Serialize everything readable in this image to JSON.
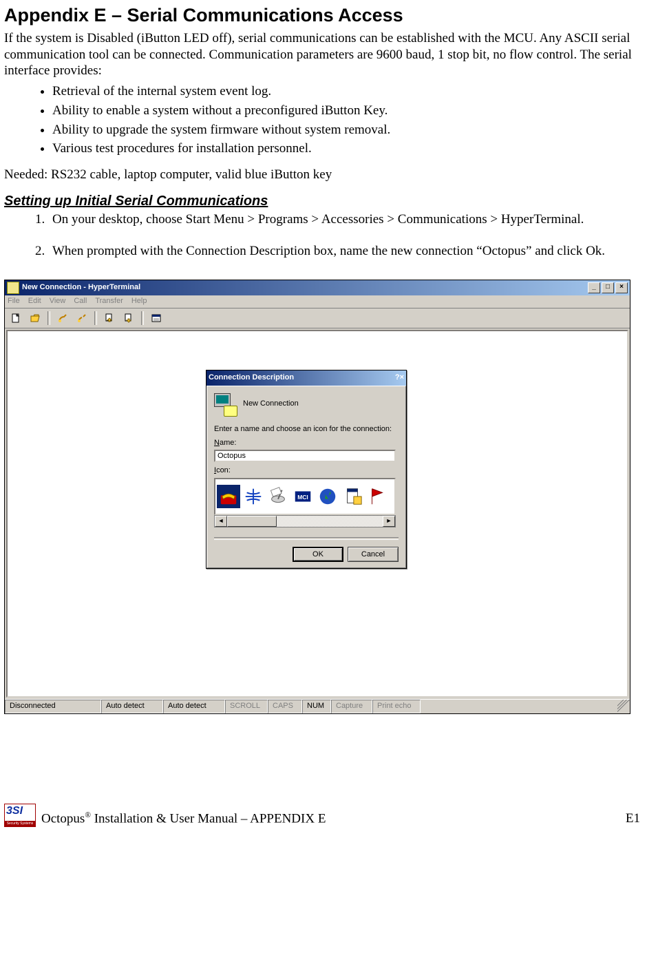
{
  "heading": "Appendix E – Serial Communications Access",
  "intro": "If the system is Disabled (iButton LED off), serial communications can be established with the MCU. Any ASCII serial communication tool can be connected. Communication parameters are 9600 baud, 1 stop bit, no flow control. The serial interface provides:",
  "bullets": [
    "Retrieval of the internal system event log.",
    "Ability to enable a system without a preconfigured iButton Key.",
    "Ability to upgrade the system firmware without system removal.",
    "Various test procedures for installation personnel."
  ],
  "needed": "Needed: RS232 cable, laptop computer, valid blue iButton key",
  "subheading": "Setting up Initial Serial Communications",
  "steps": [
    "On your desktop, choose Start Menu > Programs > Accessories > Communications > HyperTerminal.",
    "When prompted with the Connection Description box, name the new connection “Octopus” and click Ok."
  ],
  "ht": {
    "title": "New Connection - HyperTerminal",
    "menus": [
      "File",
      "Edit",
      "View",
      "Call",
      "Transfer",
      "Help"
    ],
    "status": {
      "conn": "Disconnected",
      "ad1": "Auto detect",
      "ad2": "Auto detect",
      "scroll": "SCROLL",
      "caps": "CAPS",
      "num": "NUM",
      "capture": "Capture",
      "echo": "Print echo"
    }
  },
  "dlg": {
    "title": "Connection Description",
    "newconn": "New Connection",
    "instruction": "Enter a name and choose an icon for the connection:",
    "name_label": "Name:",
    "name_value": "Octopus",
    "icon_label": "Icon:",
    "ok": "OK",
    "cancel": "Cancel"
  },
  "footer": {
    "text_prefix": "Octopus",
    "text_suffix": " Installation & User Manual – APPENDIX E",
    "page": "E1"
  }
}
